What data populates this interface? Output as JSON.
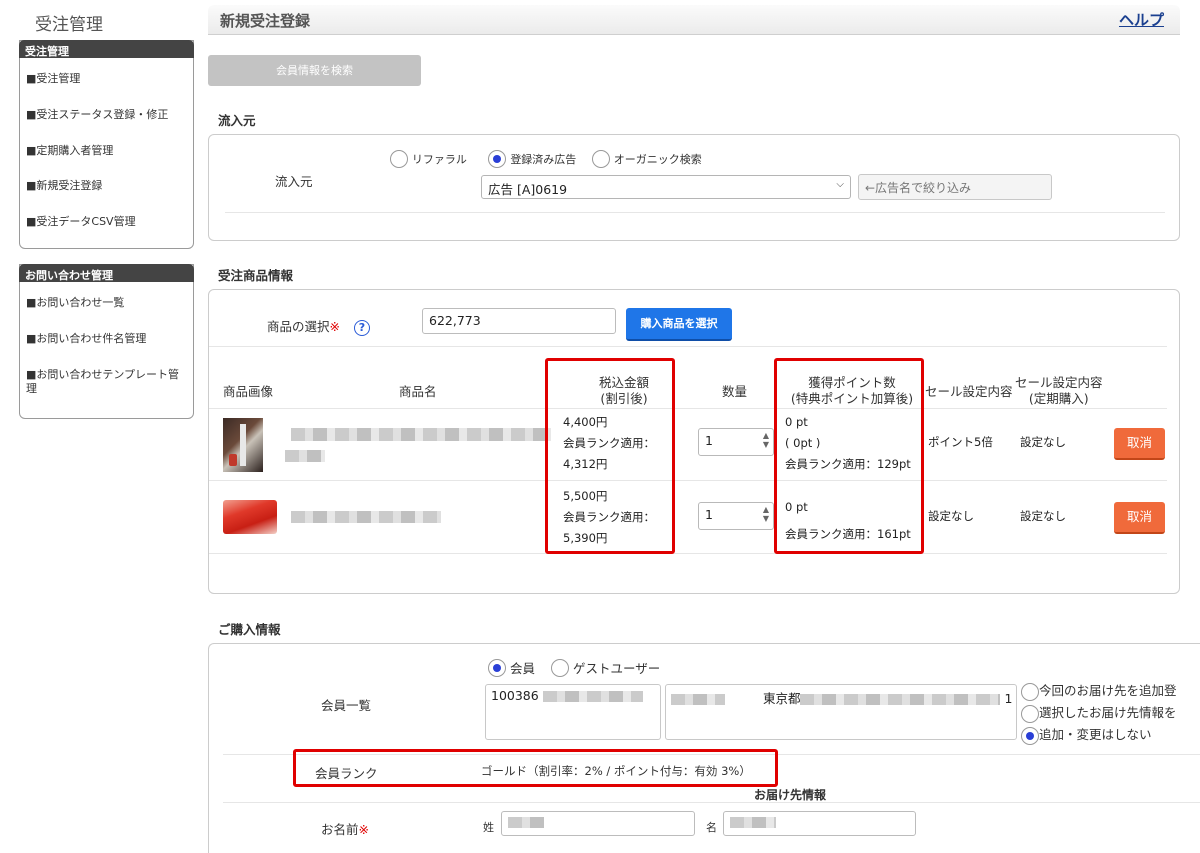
{
  "sidebar": {
    "title": "受注管理",
    "sections": [
      {
        "header": "受注管理",
        "items": [
          "■受注管理",
          "■受注ステータス登録・修正",
          "■定期購入者管理",
          "■新規受注登録",
          "■受注データCSV管理"
        ]
      },
      {
        "header": "お問い合わせ管理",
        "items": [
          "■お問い合わせ一覧",
          "■お問い合わせ件名管理",
          "■お問い合わせテンプレート管理"
        ]
      }
    ]
  },
  "header": {
    "title": "新規受注登録",
    "help": "ヘルプ"
  },
  "member_search_button": "会員情報を検索",
  "source": {
    "section_title": "流入元",
    "label": "流入元",
    "radios": [
      {
        "label": "リファラル",
        "selected": false
      },
      {
        "label": "登録済み広告",
        "selected": true
      },
      {
        "label": "オーガニック検索",
        "selected": false
      }
    ],
    "select_value": "広告 [A]0619",
    "filter_placeholder": "←広告名で絞り込み"
  },
  "products": {
    "section_title": "受注商品情報",
    "select_label": "商品の選択",
    "required_mark": "※",
    "help_mark": "?",
    "input_value": "622,773",
    "select_button": "購入商品を選択",
    "columns": {
      "image": "商品画像",
      "name": "商品名",
      "price_line1": "税込金額",
      "price_line2": "(割引後)",
      "qty": "数量",
      "points_line1": "獲得ポイント数",
      "points_line2": "(特典ポイント加算後)",
      "sale": "セール設定内容",
      "sale_sub_line1": "セール設定内容",
      "sale_sub_line2": "(定期購入)"
    },
    "rows": [
      {
        "price": "4,400円",
        "price_rank_label": "会員ランク適用：",
        "price_rank": "4,312円",
        "qty": "1",
        "points": "0 pt",
        "points_bonus": "( 0pt )",
        "points_rank": "会員ランク適用：129pt",
        "sale": "ポイント5倍",
        "sale_sub": "設定なし",
        "cancel": "取消"
      },
      {
        "price": "5,500円",
        "price_rank_label": "会員ランク適用：",
        "price_rank": "5,390円",
        "qty": "1",
        "points": "0 pt",
        "points_bonus": "",
        "points_rank": "会員ランク適用：161pt",
        "sale": "設定なし",
        "sale_sub": "設定なし",
        "cancel": "取消"
      }
    ]
  },
  "purchase": {
    "section_title": "ご購入情報",
    "member_type_radios": [
      {
        "label": "会員",
        "selected": true
      },
      {
        "label": "ゲストユーザー",
        "selected": false
      }
    ],
    "member_list_label": "会員一覧",
    "member_id": "100386",
    "member_address_prefix": "東京都",
    "member_address_suffix": "1",
    "delivery_options": [
      {
        "label": "今回のお届け先を追加登",
        "selected": false
      },
      {
        "label": "選択したお届け先情報を",
        "selected": false
      },
      {
        "label": "追加・変更はしない",
        "selected": true
      }
    ],
    "rank_label": "会員ランク",
    "rank_value": "ゴールド（割引率：2% / ポイント付与：有効 3%）",
    "delivery_header": "お届け先情報",
    "name_label": "お名前",
    "last_name_label": "姓",
    "first_name_label": "名"
  }
}
